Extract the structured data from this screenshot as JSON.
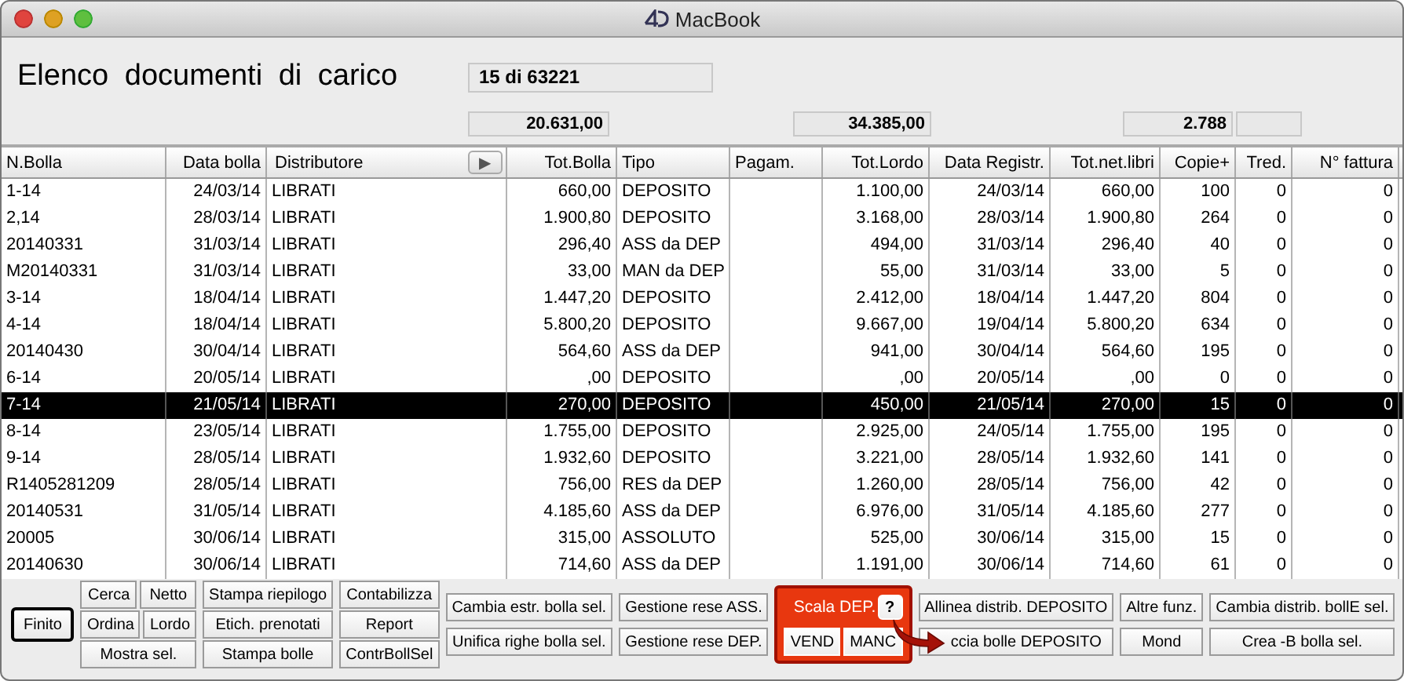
{
  "window": {
    "title": "MacBook"
  },
  "header": {
    "title": "Elenco documenti di carico",
    "record_count": "15 di 63221",
    "totals": [
      "20.631,00",
      "34.385,00",
      "2.788"
    ]
  },
  "table": {
    "columns": [
      {
        "label": "N.Bolla"
      },
      {
        "label": "Data bolla"
      },
      {
        "label": "Distributore",
        "button": "▶"
      },
      {
        "label": "Tot.Bolla"
      },
      {
        "label": "Tipo"
      },
      {
        "label": "Pagam."
      },
      {
        "label": "Tot.Lordo"
      },
      {
        "label": "Data Registr."
      },
      {
        "label": "Tot.net.libri"
      },
      {
        "label": "Copie+"
      },
      {
        "label": "Tred."
      },
      {
        "label": "N° fattura"
      }
    ],
    "rows": [
      {
        "selected": false,
        "cells": [
          "1-14",
          "24/03/14",
          "LIBRATI",
          "660,00",
          "DEPOSITO",
          null,
          "1.100,00",
          "24/03/14",
          "660,00",
          "100",
          "0",
          "0"
        ]
      },
      {
        "selected": false,
        "cells": [
          "2,14",
          "28/03/14",
          "LIBRATI",
          "1.900,80",
          "DEPOSITO",
          null,
          "3.168,00",
          "28/03/14",
          "1.900,80",
          "264",
          "0",
          "0"
        ]
      },
      {
        "selected": false,
        "cells": [
          "20140331",
          "31/03/14",
          "LIBRATI",
          "296,40",
          "ASS da DEP",
          null,
          "494,00",
          "31/03/14",
          "296,40",
          "40",
          "0",
          "0"
        ]
      },
      {
        "selected": false,
        "cells": [
          "M20140331",
          "31/03/14",
          "LIBRATI",
          "33,00",
          "MAN da DEP",
          null,
          "55,00",
          "31/03/14",
          "33,00",
          "5",
          "0",
          "0"
        ]
      },
      {
        "selected": false,
        "cells": [
          "3-14",
          "18/04/14",
          "LIBRATI",
          "1.447,20",
          "DEPOSITO",
          null,
          "2.412,00",
          "18/04/14",
          "1.447,20",
          "804",
          "0",
          "0"
        ]
      },
      {
        "selected": false,
        "cells": [
          "4-14",
          "18/04/14",
          "LIBRATI",
          "5.800,20",
          "DEPOSITO",
          null,
          "9.667,00",
          "19/04/14",
          "5.800,20",
          "634",
          "0",
          "0"
        ]
      },
      {
        "selected": false,
        "cells": [
          "20140430",
          "30/04/14",
          "LIBRATI",
          "564,60",
          "ASS da DEP",
          null,
          "941,00",
          "30/04/14",
          "564,60",
          "195",
          "0",
          "0"
        ]
      },
      {
        "selected": false,
        "cells": [
          "6-14",
          "20/05/14",
          "LIBRATI",
          ",00",
          "DEPOSITO",
          null,
          ",00",
          "20/05/14",
          ",00",
          "0",
          "0",
          "0"
        ]
      },
      {
        "selected": true,
        "cells": [
          "7-14",
          "21/05/14",
          "LIBRATI",
          "270,00",
          "DEPOSITO",
          null,
          "450,00",
          "21/05/14",
          "270,00",
          "15",
          "0",
          "0"
        ]
      },
      {
        "selected": false,
        "cells": [
          "8-14",
          "23/05/14",
          "LIBRATI",
          "1.755,00",
          "DEPOSITO",
          null,
          "2.925,00",
          "24/05/14",
          "1.755,00",
          "195",
          "0",
          "0"
        ]
      },
      {
        "selected": false,
        "cells": [
          "9-14",
          "28/05/14",
          "LIBRATI",
          "1.932,60",
          "DEPOSITO",
          null,
          "3.221,00",
          "28/05/14",
          "1.932,60",
          "141",
          "0",
          "0"
        ]
      },
      {
        "selected": false,
        "cells": [
          "R1405281209",
          "28/05/14",
          "LIBRATI",
          "756,00",
          "RES da DEP",
          null,
          "1.260,00",
          "28/05/14",
          "756,00",
          "42",
          "0",
          "0"
        ]
      },
      {
        "selected": false,
        "cells": [
          "20140531",
          "31/05/14",
          "LIBRATI",
          "4.185,60",
          "ASS da DEP",
          null,
          "6.976,00",
          "31/05/14",
          "4.185,60",
          "277",
          "0",
          "0"
        ]
      },
      {
        "selected": false,
        "cells": [
          "20005",
          "30/06/14",
          "LIBRATI",
          "315,00",
          "ASSOLUTO",
          null,
          "525,00",
          "30/06/14",
          "315,00",
          "15",
          "0",
          "0"
        ]
      },
      {
        "selected": false,
        "cells": [
          "20140630",
          "30/06/14",
          "LIBRATI",
          "714,60",
          "ASS da DEP",
          null,
          "1.191,00",
          "30/06/14",
          "714,60",
          "61",
          "0",
          "0"
        ]
      }
    ]
  },
  "toolbar": {
    "groups": [
      {
        "kind": "default",
        "rows": [
          [
            "Finito"
          ]
        ]
      },
      {
        "kind": "stack",
        "rows": [
          [
            "Cerca",
            "Netto"
          ],
          [
            "Ordina",
            "Lordo"
          ],
          [
            "Mostra sel."
          ]
        ]
      },
      {
        "kind": "stack",
        "rows": [
          [
            "Stampa riepilogo"
          ],
          [
            "Etich. prenotati"
          ],
          [
            "Stampa bolle"
          ]
        ]
      },
      {
        "kind": "stack",
        "rows": [
          [
            "Contabilizza"
          ],
          [
            "Report"
          ],
          [
            "ContrBollSel"
          ]
        ]
      },
      {
        "kind": "stack",
        "rows": [
          [
            "Cambia estr. bolla sel."
          ],
          [
            "Unifica righe bolla sel."
          ]
        ]
      },
      {
        "kind": "stack",
        "rows": [
          [
            "Gestione rese ASS."
          ],
          [
            "Gestione rese DEP."
          ]
        ]
      },
      {
        "kind": "panel",
        "label": "Scala DEP.",
        "help": "?",
        "rows": [
          [
            "VEND",
            "MANC"
          ]
        ]
      },
      {
        "kind": "stack",
        "rows": [
          [
            "Allinea distrib. DEPOSITO"
          ],
          [
            "ccia bolle DEPOSITO"
          ]
        ]
      },
      {
        "kind": "stack",
        "rows": [
          [
            "Altre funz."
          ],
          [
            "Mond"
          ]
        ]
      },
      {
        "kind": "stack",
        "rows": [
          [
            "Cambia distrib. bollE sel."
          ],
          [
            "Crea -B bolla sel."
          ]
        ]
      }
    ]
  }
}
